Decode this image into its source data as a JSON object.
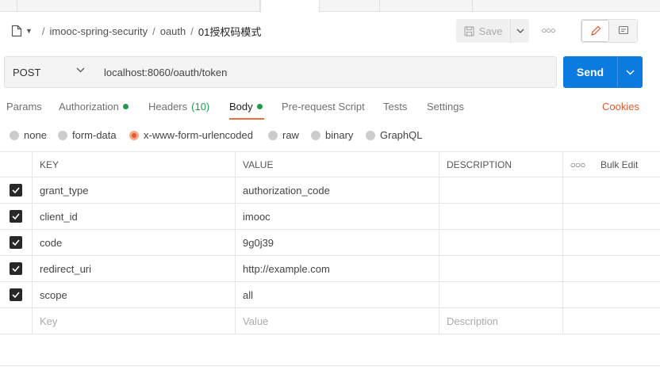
{
  "breadcrumb": {
    "items": [
      "imooc-spring-security",
      "oauth",
      "01授权码模式"
    ]
  },
  "toolbar": {
    "save_label": "Save",
    "more_icon": "ellipsis-icon",
    "edit_icon": "pencil-icon",
    "comment_icon": "comment-icon"
  },
  "request": {
    "method": "POST",
    "url": "localhost:8060/oauth/token",
    "send_label": "Send"
  },
  "tabs": {
    "params": "Params",
    "authorization": "Authorization",
    "headers": "Headers",
    "headers_count": "(10)",
    "body": "Body",
    "pre_request": "Pre-request Script",
    "tests": "Tests",
    "settings": "Settings",
    "cookies": "Cookies",
    "active": "Body"
  },
  "body_types": {
    "none": "none",
    "form_data": "form-data",
    "urlencoded": "x-www-form-urlencoded",
    "raw": "raw",
    "binary": "binary",
    "graphql": "GraphQL",
    "selected": "x-www-form-urlencoded"
  },
  "table": {
    "headers": {
      "key": "KEY",
      "value": "VALUE",
      "description": "DESCRIPTION",
      "bulk_edit": "Bulk Edit"
    },
    "rows": [
      {
        "key": "grant_type",
        "value": "authorization_code",
        "description": "",
        "checked": true
      },
      {
        "key": "client_id",
        "value": "imooc",
        "description": "",
        "checked": true
      },
      {
        "key": "code",
        "value": "9g0j39",
        "description": "",
        "checked": true
      },
      {
        "key": "redirect_uri",
        "value": "http://example.com",
        "description": "",
        "checked": true
      },
      {
        "key": "scope",
        "value": "all",
        "description": "",
        "checked": true
      }
    ],
    "placeholders": {
      "key": "Key",
      "value": "Value",
      "description": "Description"
    }
  },
  "colors": {
    "accent": "#e4592f",
    "send": "#0b7be0",
    "green_dot": "#1f9b4a"
  }
}
